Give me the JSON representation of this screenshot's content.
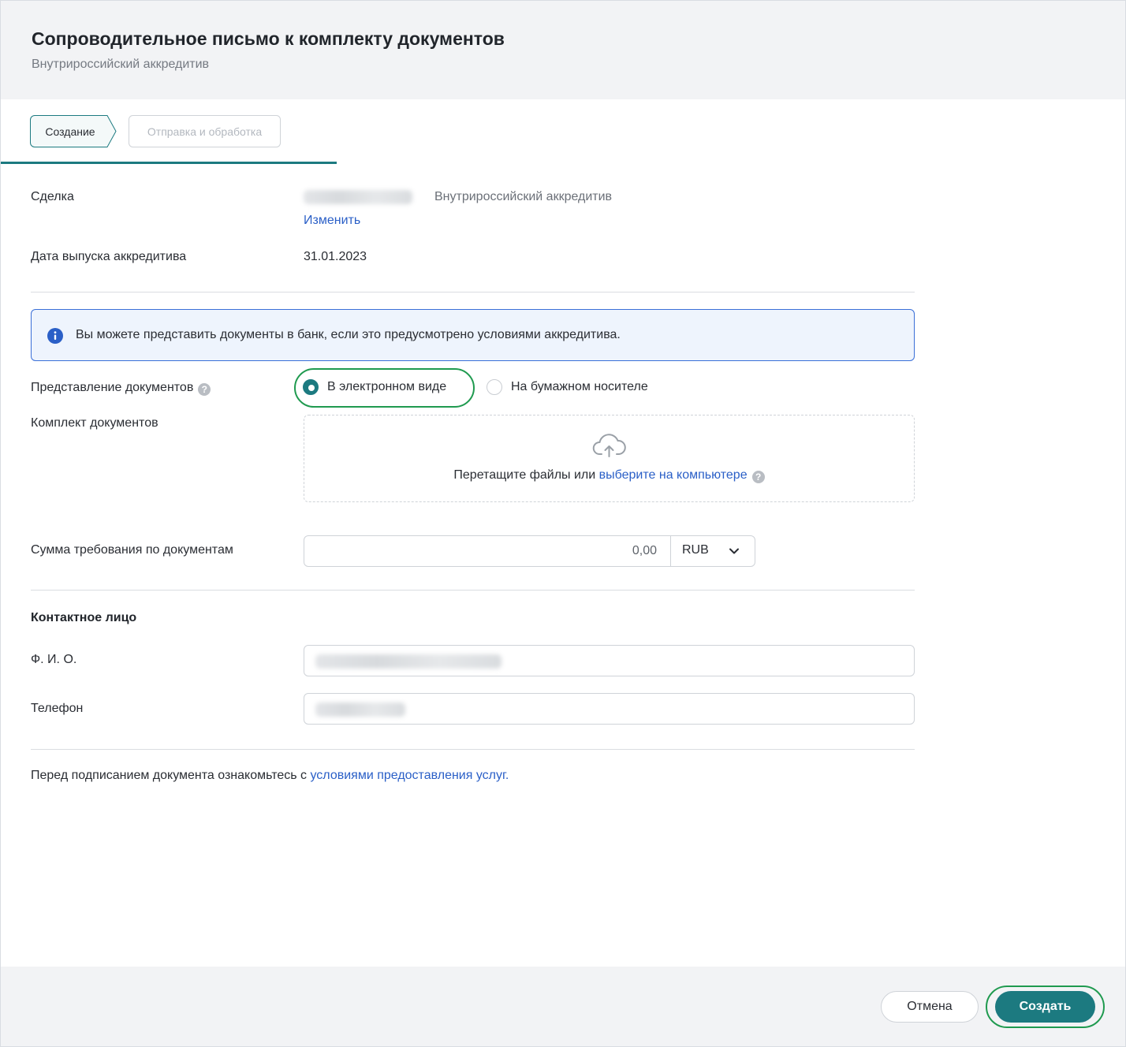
{
  "header": {
    "title": "Сопроводительное письмо к комплекту документов",
    "subtitle": "Внутрироссийский аккредитив"
  },
  "steps": [
    {
      "label": "Создание",
      "state": "active"
    },
    {
      "label": "Отправка и обработка",
      "state": "inactive"
    }
  ],
  "deal": {
    "label": "Сделка",
    "type": "Внутрироссийский аккредитив",
    "change_link": "Изменить"
  },
  "issue_date": {
    "label": "Дата выпуска аккредитива",
    "value": "31.01.2023"
  },
  "info_banner": {
    "text": "Вы можете представить документы в банк, если это предусмотрено условиями аккредитива."
  },
  "presentation": {
    "label": "Представление документов",
    "options": [
      {
        "label": "В электронном виде",
        "selected": true
      },
      {
        "label": "На бумажном носителе",
        "selected": false
      }
    ]
  },
  "documents": {
    "label": "Комплект документов",
    "drop_text": "Перетащите файлы или",
    "drop_link": "выберите на компьютере"
  },
  "amount": {
    "label": "Сумма требования по документам",
    "value": "0,00",
    "currency": "RUB"
  },
  "contact": {
    "section_title": "Контактное лицо",
    "name_label": "Ф. И. О.",
    "phone_label": "Телефон"
  },
  "terms": {
    "prefix": "Перед подписанием документа ознакомьтесь с",
    "link": "условиями предоставления услуг",
    "suffix": "."
  },
  "footer": {
    "cancel_label": "Отмена",
    "create_label": "Создать"
  },
  "colors": {
    "accent": "#1c7a80",
    "highlight": "#1f9a4f",
    "link": "#2a5fc7",
    "info_border": "#3a6fd8"
  }
}
